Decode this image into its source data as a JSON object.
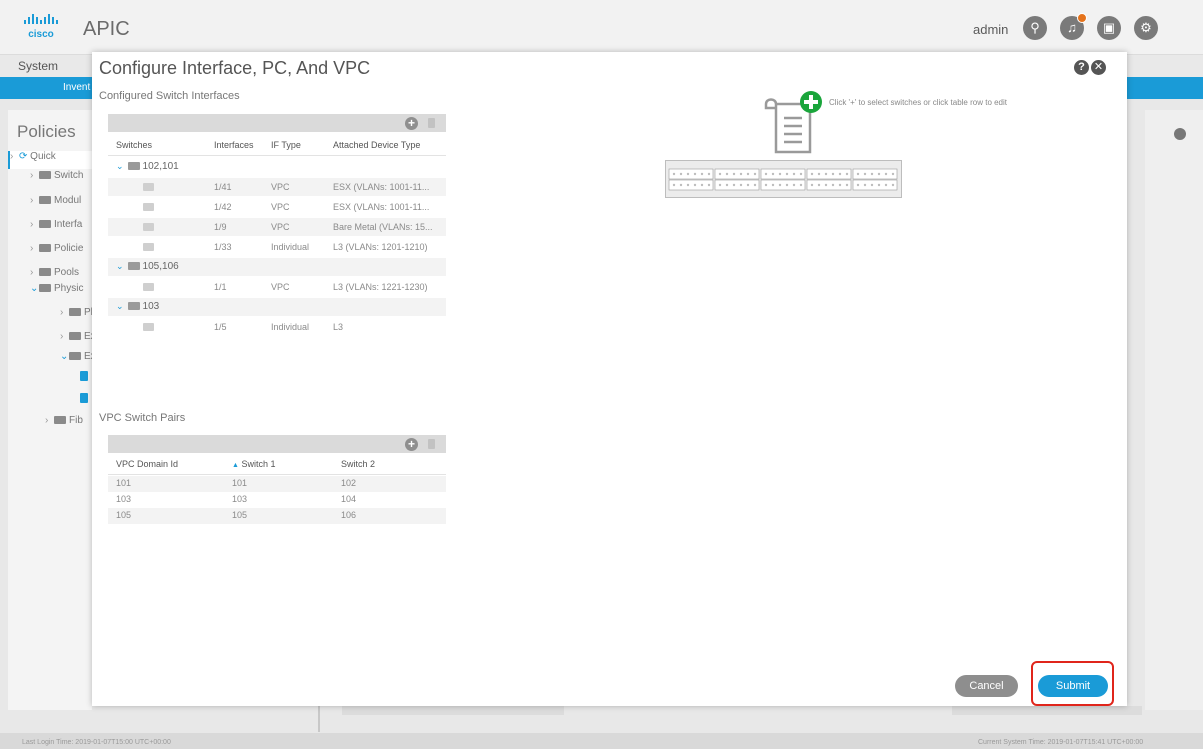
{
  "app": {
    "title": "APIC",
    "user": "admin",
    "logo_text": "cisco",
    "nav_item": "System",
    "subnav_item": "Invent"
  },
  "icons": {
    "search": "search-icon",
    "notifications": "bell-icon",
    "screen": "monitor-icon",
    "settings": "gear-icon"
  },
  "colors": {
    "accent": "#1a9bd7",
    "add": "#1aa53b",
    "highlight": "#e0251b",
    "notification_badge": "#e5731c"
  },
  "sidebar": {
    "title": "Policies",
    "items": [
      {
        "label": "Quick",
        "level": 0,
        "expanded": false
      },
      {
        "label": "Switch",
        "level": 0,
        "expanded": false
      },
      {
        "label": "Modul",
        "level": 0,
        "expanded": false
      },
      {
        "label": "Interfa",
        "level": 0,
        "expanded": false
      },
      {
        "label": "Policie",
        "level": 0,
        "expanded": false
      },
      {
        "label": "Pools",
        "level": 0,
        "expanded": false
      },
      {
        "label": "Physic",
        "level": 0,
        "expanded": true
      },
      {
        "label": "Ph",
        "level": 1,
        "expanded": false
      },
      {
        "label": "Ext",
        "level": 1,
        "expanded": false
      },
      {
        "label": "Ext",
        "level": 1,
        "expanded": true
      },
      {
        "label": "Fib",
        "level": 1,
        "expanded": false
      }
    ]
  },
  "footer": {
    "last_login": "Last Login Time: 2019-01-07T15:00 UTC+00:00",
    "current_time": "Current System Time: 2019-01-07T15:41 UTC+00:00"
  },
  "modal": {
    "title": "Configure Interface, PC, And VPC",
    "configured_label": "Configured Switch Interfaces",
    "interfaces_table": {
      "columns": [
        "Switches",
        "Interfaces",
        "IF Type",
        "Attached Device Type"
      ],
      "groups": [
        {
          "name": "102,101",
          "rows": [
            {
              "interface": "1/41",
              "type": "VPC",
              "device": "ESX (VLANs: 1001-11..."
            },
            {
              "interface": "1/42",
              "type": "VPC",
              "device": "ESX (VLANs: 1001-11..."
            },
            {
              "interface": "1/9",
              "type": "VPC",
              "device": "Bare Metal (VLANs: 15..."
            },
            {
              "interface": "1/33",
              "type": "Individual",
              "device": "L3 (VLANs: 1201-1210)"
            }
          ]
        },
        {
          "name": "105,106",
          "rows": [
            {
              "interface": "1/1",
              "type": "VPC",
              "device": "L3 (VLANs: 1221-1230)"
            }
          ]
        },
        {
          "name": "103",
          "rows": [
            {
              "interface": "1/5",
              "type": "Individual",
              "device": "L3"
            }
          ]
        }
      ]
    },
    "vpc_label": "VPC Switch Pairs",
    "vpc_table": {
      "columns": [
        "VPC Domain Id",
        "Switch 1",
        "Switch 2"
      ],
      "sort_indicator": "▲",
      "rows": [
        [
          "101",
          "101",
          "102"
        ],
        [
          "103",
          "103",
          "104"
        ],
        [
          "105",
          "105",
          "106"
        ]
      ]
    },
    "hint": "Click '+' to select switches or click table row to edit",
    "cancel_label": "Cancel",
    "submit_label": "Submit"
  }
}
